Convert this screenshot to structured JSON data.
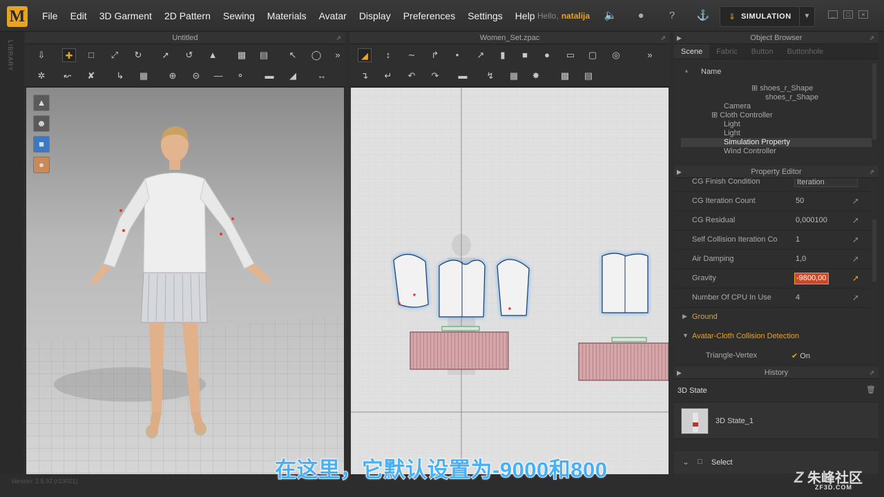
{
  "menubar": {
    "logo": "M",
    "items": [
      "File",
      "Edit",
      "3D Garment",
      "2D Pattern",
      "Sewing",
      "Materials",
      "Avatar",
      "Display",
      "Preferences",
      "Settings",
      "Help"
    ],
    "hello": "Hello,",
    "user": "natalija",
    "simulation_label": "SIMULATION"
  },
  "sidebar": {
    "library": "LIBRARY"
  },
  "view3d": {
    "title": "Untitled"
  },
  "view2d": {
    "title": "Women_Set.zpac"
  },
  "object_browser": {
    "title": "Object Browser",
    "tabs": [
      "Scene",
      "Fabric",
      "Button",
      "Buttonhole"
    ],
    "name_header": "Name",
    "items": [
      "shoes_r_Shape",
      "shoes_r_Shape",
      "Camera",
      "Cloth Controller",
      "Light",
      "Light",
      "Simulation Property",
      "Wind Controller"
    ],
    "selected": "Simulation Property"
  },
  "property_editor": {
    "title": "Property Editor",
    "rows": [
      {
        "label": "CG Finish Condition",
        "value": "Iteration"
      },
      {
        "label": "CG Iteration Count",
        "value": "50"
      },
      {
        "label": "CG Residual",
        "value": "0,000100"
      },
      {
        "label": "Self Collision Iteration Co",
        "value": "1"
      },
      {
        "label": "Air Damping",
        "value": "1,0"
      },
      {
        "label": "Gravity",
        "value": "-9800,00"
      },
      {
        "label": "Number Of CPU In Use",
        "value": "4"
      }
    ],
    "section_ground": "Ground",
    "section_collision": "Avatar-Cloth Collision Detection",
    "triangle_vertex_label": "Triangle-Vertex",
    "triangle_vertex_value": "On"
  },
  "history": {
    "title": "History",
    "state_header": "3D State",
    "state_item": "3D State_1",
    "select_label": "Select"
  },
  "subtitle": "在这里，它默认设置为-9000和800",
  "watermark": {
    "main": "朱峰社区",
    "sub": "ZF3D.COM"
  },
  "version": "Version: 2.5.92  (r23021)",
  "colors": {
    "accent": "#e8a320",
    "subtitle": "#4ab0f5"
  }
}
